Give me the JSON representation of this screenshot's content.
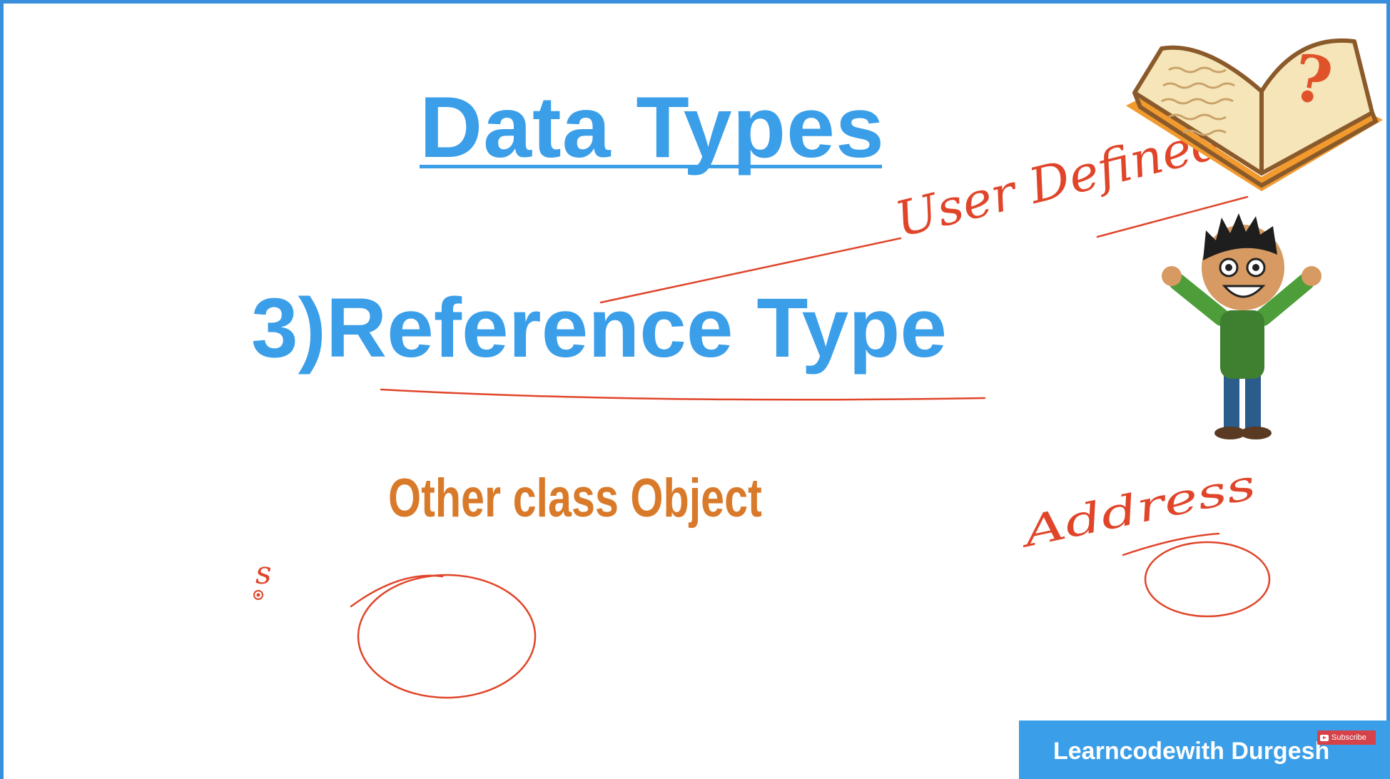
{
  "slide": {
    "title": "Data Types",
    "heading": "3)Reference Type",
    "subheading": "Other class Object"
  },
  "annotations": {
    "user_defined": "User Defined",
    "address": "Address",
    "s_mark": "s"
  },
  "branding": {
    "channel": "Learncodewith Durgesh",
    "subscribe_label": "Subscribe"
  },
  "colors": {
    "frame": "#3a8fdc",
    "title_blue": "#3a9ee8",
    "subheading_orange": "#d97a2a",
    "ink_red": "#e0452a"
  },
  "icons": [
    "question-book-icon",
    "cheering-boy-illustration",
    "play-icon"
  ]
}
